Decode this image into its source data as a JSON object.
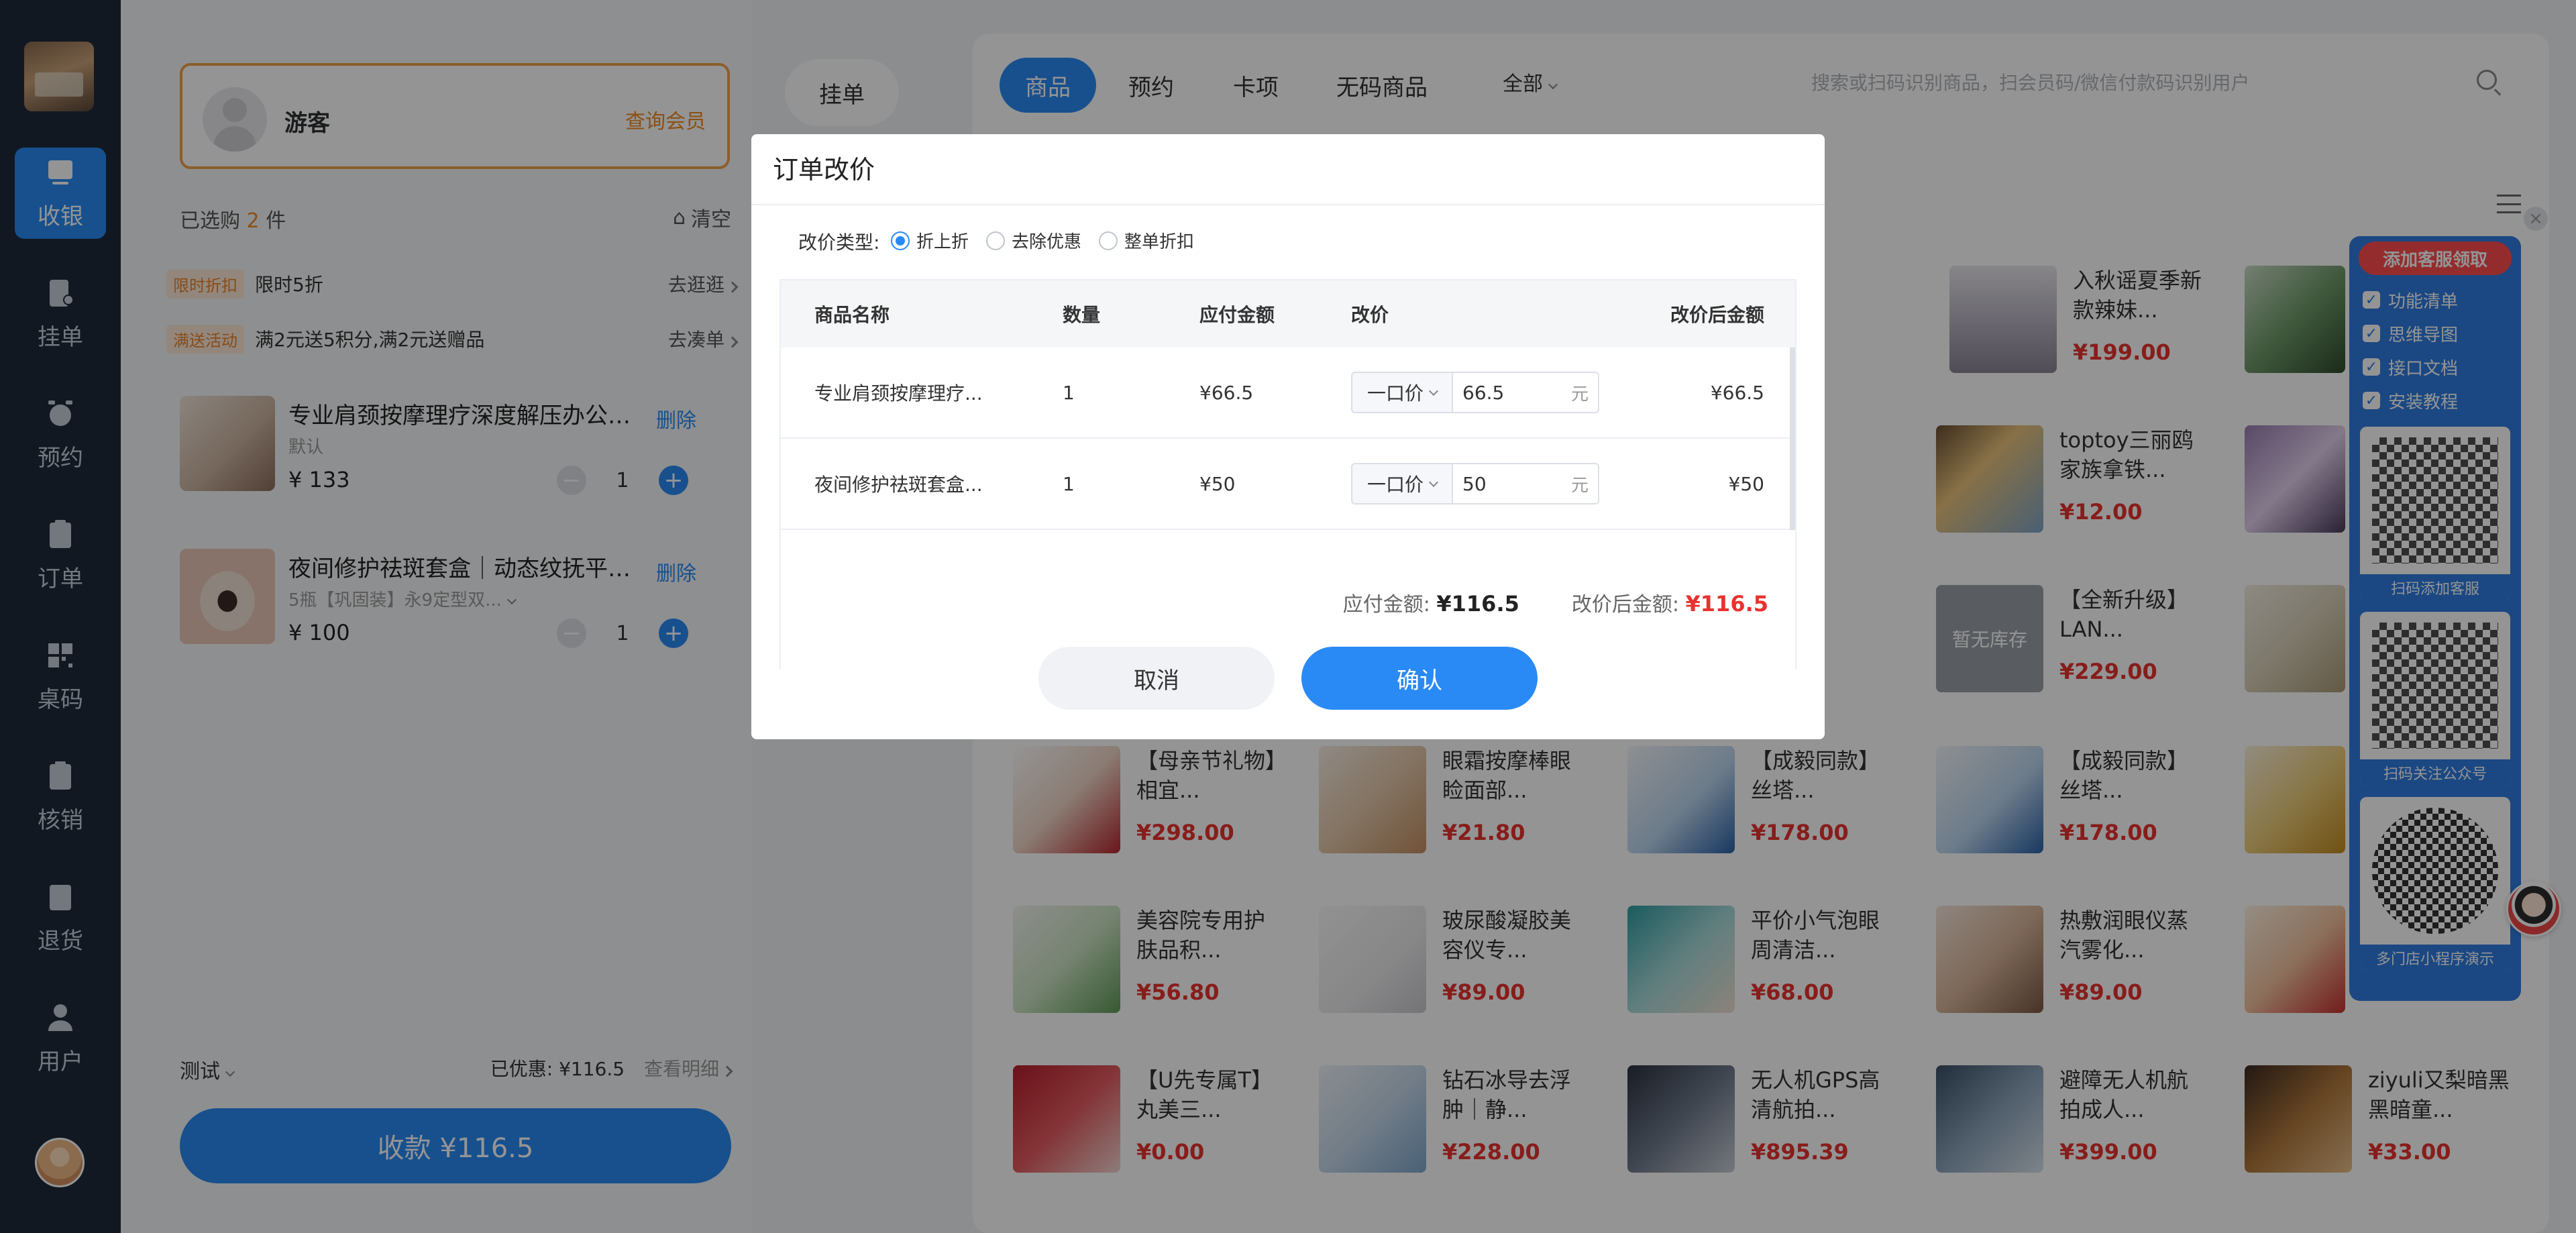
{
  "sidebar": {
    "items": [
      {
        "label": "收银",
        "icon": "cashier-icon",
        "active": true
      },
      {
        "label": "挂单",
        "icon": "hold-order-icon"
      },
      {
        "label": "预约",
        "icon": "alarm-clock-icon"
      },
      {
        "label": "订单",
        "icon": "order-list-icon"
      },
      {
        "label": "桌码",
        "icon": "qr-grid-icon"
      },
      {
        "label": "核销",
        "icon": "verify-icon"
      },
      {
        "label": "退货",
        "icon": "return-icon"
      },
      {
        "label": "用户",
        "icon": "user-icon"
      }
    ]
  },
  "cart": {
    "member_name": "游客",
    "member_link": "查询会员",
    "hang_button": "挂单",
    "selected_prefix": "已选购",
    "selected_count": "2",
    "selected_suffix": "件",
    "clear_label": "清空",
    "promos": [
      {
        "tag": "限时折扣",
        "text": "限时5折",
        "more": "去逛逛"
      },
      {
        "tag": "满送活动",
        "text": "满2元送5积分,满2元送赠品",
        "more": "去凑单"
      }
    ],
    "items": [
      {
        "title": "专业肩颈按摩理疗深度解压办公室...",
        "sub": "默认",
        "price": "¥ 133",
        "qty": "1",
        "delete": "删除"
      },
      {
        "title": "夜间修护祛斑套盒｜动态纹抚平术...",
        "sub": "5瓶【巩固装】永9定型双...",
        "price": "¥ 100",
        "qty": "1",
        "delete": "删除"
      }
    ],
    "note": "测试",
    "discount_label": "已优惠: ¥116.5",
    "detail_link": "查看明细",
    "pay_label": "收款 ¥116.5"
  },
  "products": {
    "tabs": [
      "商品",
      "预约",
      "卡项",
      "无码商品"
    ],
    "filter": "全部",
    "search_placeholder": "搜索或扫码识别商品，扫会员码/微信付款码识别用户",
    "items": [
      {
        "name": "入秋谣夏季新款辣妹...",
        "price": "¥199.00"
      },
      {
        "name": "toptoy三丽鸥家族拿铁...",
        "price": "¥12.00"
      },
      {
        "name": "【全新升级】LAN...",
        "price": "¥229.00",
        "placeholder": "暂无库存"
      },
      {
        "name": "【母亲节礼物】相宜...",
        "price": "¥298.00"
      },
      {
        "name": "眼霜按摩棒眼睑面部...",
        "price": "¥21.80"
      },
      {
        "name": "【成毅同款】丝塔...",
        "price": "¥178.00"
      },
      {
        "name": "【成毅同款】丝塔...",
        "price": "¥178.00"
      },
      {
        "name": "美容院专用护肤品积...",
        "price": "¥56.80"
      },
      {
        "name": "玻尿酸凝胶美容仪专...",
        "price": "¥89.00"
      },
      {
        "name": "平价小气泡眼周清洁...",
        "price": "¥68.00"
      },
      {
        "name": "热敷润眼仪蒸汽雾化...",
        "price": "¥89.00"
      },
      {
        "name": "【U先专属T】丸美三...",
        "price": "¥0.00"
      },
      {
        "name": "钻石冰导去浮肿｜静...",
        "price": "¥228.00"
      },
      {
        "name": "无人机GPS高清航拍...",
        "price": "¥895.39"
      },
      {
        "name": "避障无人机航拍成人...",
        "price": "¥399.00"
      },
      {
        "name": "ziyuli又梨暗黑黑暗童...",
        "price": "¥33.00"
      }
    ]
  },
  "float_panel": {
    "header": "添加客服领取",
    "list": [
      "功能清单",
      "思维导图",
      "接口文档",
      "安装教程"
    ],
    "qr_labels": [
      "扫码添加客服",
      "扫码关注公众号",
      "多门店小程序演示"
    ]
  },
  "modal": {
    "title": "订单改价",
    "price_type_label": "改价类型:",
    "radio_options": [
      "折上折",
      "去除优惠",
      "整单折扣"
    ],
    "columns": [
      "商品名称",
      "数量",
      "应付金额",
      "改价",
      "改价后金额"
    ],
    "rows": [
      {
        "name": "专业肩颈按摩理疗...",
        "qty": "1",
        "due": "¥66.5",
        "mode": "一口价",
        "value": "66.5",
        "unit": "元",
        "after": "¥66.5"
      },
      {
        "name": "夜间修护祛斑套盒...",
        "qty": "1",
        "due": "¥50",
        "mode": "一口价",
        "value": "50",
        "unit": "元",
        "after": "¥50"
      }
    ],
    "total_due_label": "应付金额:",
    "total_due": "¥116.5",
    "total_after_label": "改价后金额:",
    "total_after": "¥116.5",
    "cancel": "取消",
    "confirm": "确认"
  }
}
